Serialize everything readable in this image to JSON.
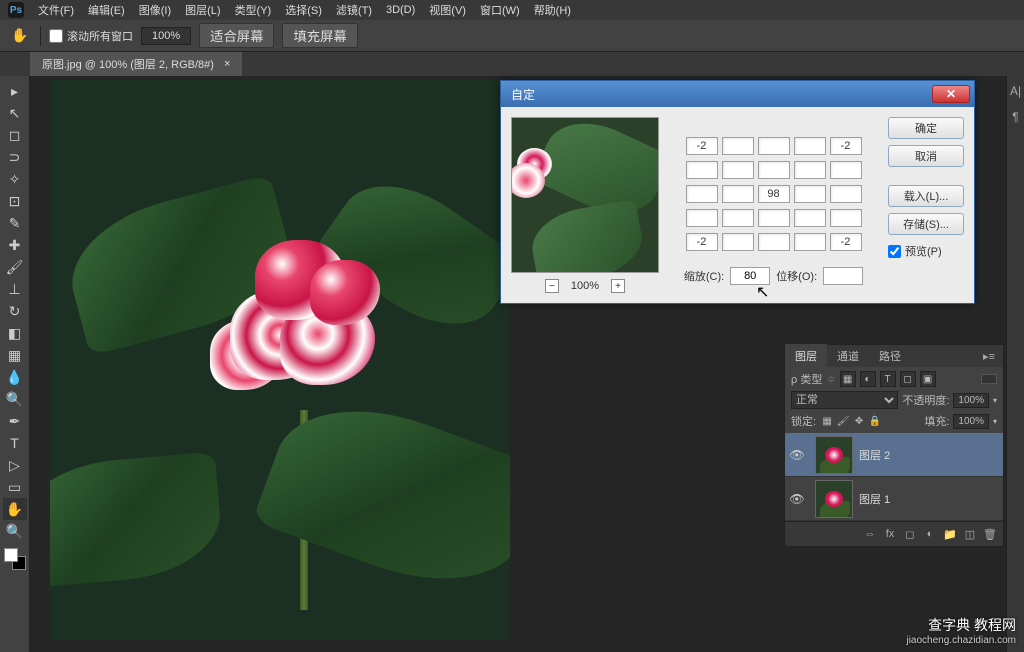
{
  "menubar": {
    "logo": "Ps",
    "items": [
      "文件(F)",
      "编辑(E)",
      "图像(I)",
      "图层(L)",
      "类型(Y)",
      "选择(S)",
      "滤镜(T)",
      "3D(D)",
      "视图(V)",
      "窗口(W)",
      "帮助(H)"
    ]
  },
  "optionsbar": {
    "scroll_all": "滚动所有窗口",
    "zoom": "100%",
    "fit_screen": "适合屏幕",
    "fill_screen": "填充屏幕"
  },
  "tab": {
    "title": "原图.jpg @ 100% (图层 2, RGB/8#)",
    "close": "×"
  },
  "dialog": {
    "title": "自定",
    "matrix": [
      [
        "-2",
        "",
        "",
        "",
        "-2"
      ],
      [
        "",
        "",
        "",
        "",
        ""
      ],
      [
        "",
        "",
        "98",
        "",
        ""
      ],
      [
        "",
        "",
        "",
        "",
        ""
      ],
      [
        "-2",
        "",
        "",
        "",
        "-2"
      ]
    ],
    "scale_label": "缩放(C):",
    "scale_value": "80",
    "offset_label": "位移(O):",
    "offset_value": "",
    "preview_zoom": "100%",
    "buttons": {
      "ok": "确定",
      "cancel": "取消",
      "load": "载入(L)...",
      "save": "存储(S)...",
      "preview": "预览(P)"
    }
  },
  "layers": {
    "tabs": [
      "图层",
      "通道",
      "路径"
    ],
    "kind_label": "ρ 类型",
    "blend_mode": "正常",
    "opacity_label": "不透明度:",
    "opacity_value": "100%",
    "lock_label": "锁定:",
    "fill_label": "填充:",
    "fill_value": "100%",
    "items": [
      {
        "name": "图层 2",
        "selected": true
      },
      {
        "name": "图层 1",
        "selected": false
      }
    ]
  },
  "watermark": {
    "main": "查字典 教程网",
    "sub": "jiaocheng.chazidian.com"
  }
}
